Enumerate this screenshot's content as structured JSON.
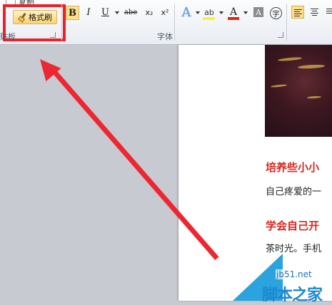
{
  "ribbon": {
    "top_cut_label": "复制",
    "format_painter": "格式刷",
    "clipboard_label": "贴板",
    "font_label": "字体",
    "tools": {
      "bold": "B",
      "italic": "I",
      "underline": "U",
      "strikethrough": "abe",
      "subscript": "x₂",
      "superscript": "x²",
      "text_effect": "A",
      "highlight": "ab",
      "font_color": "A",
      "char_shading": "A",
      "enclose": "字"
    }
  },
  "document": {
    "heading1": "培养些小小",
    "text1": "自己疼爱的一",
    "heading2": "学会自己开",
    "text2": "茶时光。手机"
  },
  "watermark": {
    "site": "jb51.net",
    "text": "脚本之家"
  },
  "colors": {
    "annotation_red": "#ed2731",
    "heading_red": "#d7261f",
    "watermark_blue": "#2aa3df"
  }
}
